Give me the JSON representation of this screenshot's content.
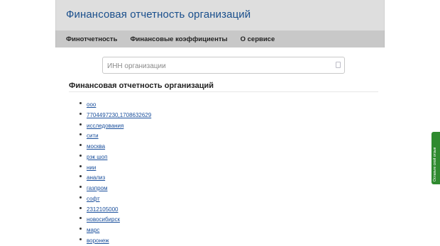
{
  "header": {
    "title": "Финансовая отчетность организаций"
  },
  "nav": {
    "items": [
      "Финотчетность",
      "Финансовые коэффициенты",
      "О сервисе"
    ]
  },
  "search": {
    "placeholder": "ИНН организации",
    "value": ""
  },
  "section": {
    "title": "Финансовая отчетность организаций"
  },
  "links": [
    "ооо",
    "7704497230,1708632629",
    "исследования",
    "сити",
    "москва",
    "рэк шоп",
    "нии",
    "анализ",
    "газпром",
    "софт",
    "2312105000",
    "новосибирск",
    "марс",
    "воронеж"
  ],
  "feedback": {
    "label": "Оставьте свой отзыв"
  },
  "colors": {
    "title": "#1a4f8c",
    "header_bg": "#dedede",
    "nav_bg": "#c8c8c8",
    "link": "#1a4f9c",
    "feedback": "#2f8a2f"
  },
  "icons": {
    "search": "search-icon"
  }
}
